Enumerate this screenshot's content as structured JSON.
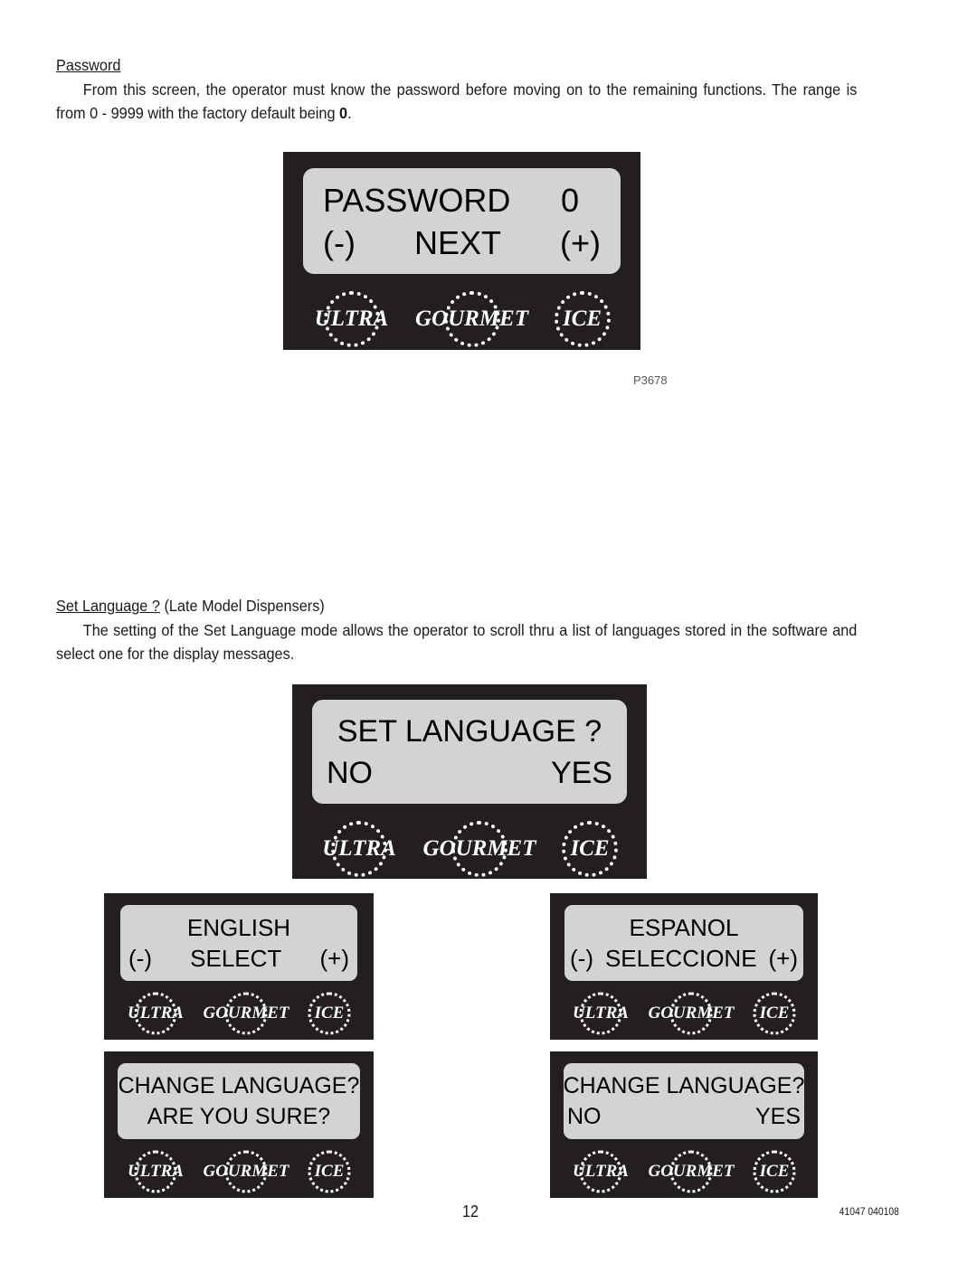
{
  "sections": [
    {
      "heading": "Password",
      "heading_suffix": "",
      "paragraph": "From this screen, the operator must know the password before moving on to the remaining functions. The range is from 0 - 9999 with the factory default being ",
      "paragraph_bold": "0",
      "paragraph_tail": "."
    },
    {
      "heading": "Set Language ?",
      "heading_suffix": " (Late Model Dispensers)",
      "paragraph": "The setting of the Set Language mode allows the operator to scroll thru a list of languages stored in the software and select one for the display messages.",
      "paragraph_bold": "",
      "paragraph_tail": ""
    }
  ],
  "brand": {
    "word1": "ULTRA",
    "word2": "GOURMET",
    "word3": "ICE"
  },
  "panels": {
    "password": {
      "line1_left": "PASSWORD",
      "line1_right": "0",
      "line2_left": "(-)",
      "line2_center": "NEXT",
      "line2_right": "(+)"
    },
    "set_language": {
      "line1_center": "SET LANGUAGE ?",
      "line2_left": "NO",
      "line2_right": "YES"
    },
    "english": {
      "line1_center": "ENGLISH",
      "line2_left": "(-)",
      "line2_center": "SELECT",
      "line2_right": "(+)"
    },
    "espanol": {
      "line1_center": "ESPANOL",
      "line2_left": "(-)",
      "line2_center": "SELECCIONE",
      "line2_right": "(+)"
    },
    "change_language_sure": {
      "line1_center": "CHANGE LANGUAGE?",
      "line2_center": "ARE YOU SURE?"
    },
    "change_language_yesno": {
      "line1_center": "CHANGE LANGUAGE?",
      "line2_left": "NO",
      "line2_right": "YES"
    }
  },
  "figure_label": "P3678",
  "footer": {
    "page_number": "12",
    "document_code": "41047 040108"
  },
  "colors": {
    "bezel": "#231f20",
    "lcd": "#d2d3d4",
    "text": "#000000",
    "caption": "#58585b"
  }
}
